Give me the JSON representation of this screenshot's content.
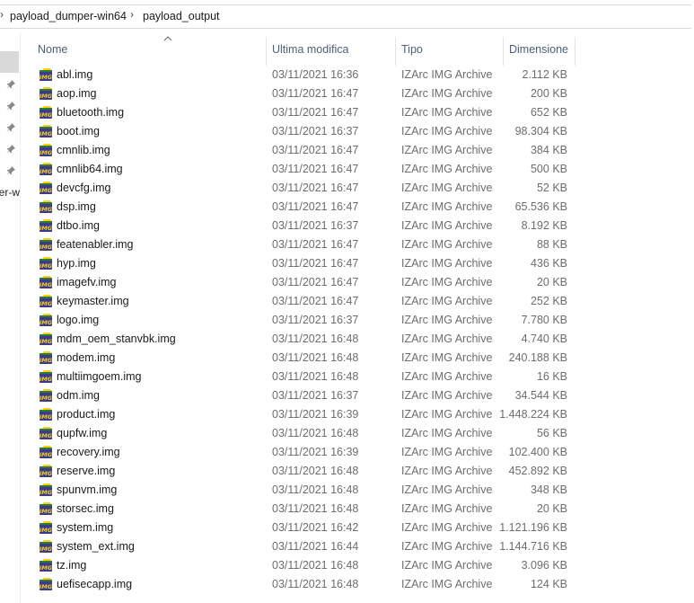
{
  "breadcrumb": {
    "items": [
      "payload_dumper-win64",
      "payload_output"
    ],
    "separator": "›"
  },
  "navpane": {
    "truncated_label": "er-w",
    "pin_count": 5
  },
  "columns": {
    "name": "Nome",
    "modified": "Ultima modifica",
    "type": "Tipo",
    "size": "Dimensione"
  },
  "files": [
    {
      "name": "abl.img",
      "modified": "03/11/2021 16:36",
      "type": "IZArc IMG Archive",
      "size": "2.112 KB"
    },
    {
      "name": "aop.img",
      "modified": "03/11/2021 16:47",
      "type": "IZArc IMG Archive",
      "size": "200 KB"
    },
    {
      "name": "bluetooth.img",
      "modified": "03/11/2021 16:47",
      "type": "IZArc IMG Archive",
      "size": "652 KB"
    },
    {
      "name": "boot.img",
      "modified": "03/11/2021 16:37",
      "type": "IZArc IMG Archive",
      "size": "98.304 KB"
    },
    {
      "name": "cmnlib.img",
      "modified": "03/11/2021 16:47",
      "type": "IZArc IMG Archive",
      "size": "384 KB"
    },
    {
      "name": "cmnlib64.img",
      "modified": "03/11/2021 16:47",
      "type": "IZArc IMG Archive",
      "size": "500 KB"
    },
    {
      "name": "devcfg.img",
      "modified": "03/11/2021 16:47",
      "type": "IZArc IMG Archive",
      "size": "52 KB"
    },
    {
      "name": "dsp.img",
      "modified": "03/11/2021 16:47",
      "type": "IZArc IMG Archive",
      "size": "65.536 KB"
    },
    {
      "name": "dtbo.img",
      "modified": "03/11/2021 16:37",
      "type": "IZArc IMG Archive",
      "size": "8.192 KB"
    },
    {
      "name": "featenabler.img",
      "modified": "03/11/2021 16:47",
      "type": "IZArc IMG Archive",
      "size": "88 KB"
    },
    {
      "name": "hyp.img",
      "modified": "03/11/2021 16:47",
      "type": "IZArc IMG Archive",
      "size": "436 KB"
    },
    {
      "name": "imagefv.img",
      "modified": "03/11/2021 16:47",
      "type": "IZArc IMG Archive",
      "size": "20 KB"
    },
    {
      "name": "keymaster.img",
      "modified": "03/11/2021 16:47",
      "type": "IZArc IMG Archive",
      "size": "252 KB"
    },
    {
      "name": "logo.img",
      "modified": "03/11/2021 16:37",
      "type": "IZArc IMG Archive",
      "size": "7.780 KB"
    },
    {
      "name": "mdm_oem_stanvbk.img",
      "modified": "03/11/2021 16:48",
      "type": "IZArc IMG Archive",
      "size": "4.740 KB"
    },
    {
      "name": "modem.img",
      "modified": "03/11/2021 16:48",
      "type": "IZArc IMG Archive",
      "size": "240.188 KB"
    },
    {
      "name": "multiimgoem.img",
      "modified": "03/11/2021 16:48",
      "type": "IZArc IMG Archive",
      "size": "16 KB"
    },
    {
      "name": "odm.img",
      "modified": "03/11/2021 16:37",
      "type": "IZArc IMG Archive",
      "size": "34.544 KB"
    },
    {
      "name": "product.img",
      "modified": "03/11/2021 16:39",
      "type": "IZArc IMG Archive",
      "size": "1.448.224 KB"
    },
    {
      "name": "qupfw.img",
      "modified": "03/11/2021 16:48",
      "type": "IZArc IMG Archive",
      "size": "56 KB"
    },
    {
      "name": "recovery.img",
      "modified": "03/11/2021 16:39",
      "type": "IZArc IMG Archive",
      "size": "102.400 KB"
    },
    {
      "name": "reserve.img",
      "modified": "03/11/2021 16:48",
      "type": "IZArc IMG Archive",
      "size": "452.892 KB"
    },
    {
      "name": "spunvm.img",
      "modified": "03/11/2021 16:48",
      "type": "IZArc IMG Archive",
      "size": "348 KB"
    },
    {
      "name": "storsec.img",
      "modified": "03/11/2021 16:48",
      "type": "IZArc IMG Archive",
      "size": "20 KB"
    },
    {
      "name": "system.img",
      "modified": "03/11/2021 16:42",
      "type": "IZArc IMG Archive",
      "size": "1.121.196 KB"
    },
    {
      "name": "system_ext.img",
      "modified": "03/11/2021 16:44",
      "type": "IZArc IMG Archive",
      "size": "1.144.716 KB"
    },
    {
      "name": "tz.img",
      "modified": "03/11/2021 16:48",
      "type": "IZArc IMG Archive",
      "size": "3.096 KB"
    },
    {
      "name": "uefisecapp.img",
      "modified": "03/11/2021 16:48",
      "type": "IZArc IMG Archive",
      "size": "124 KB"
    }
  ],
  "icon": {
    "semantic": "izarc-img-file-icon",
    "label": "IMG",
    "colors": {
      "body": "#3d3a8c",
      "label": "#f2d21a",
      "stripe": "#2f7d32"
    }
  }
}
